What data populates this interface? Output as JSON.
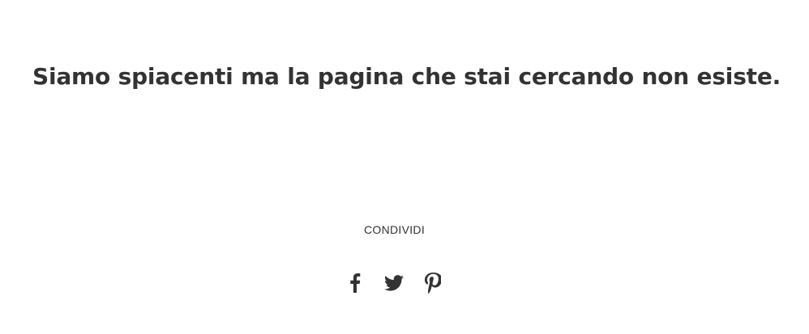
{
  "error": {
    "message": "Siamo spiacenti ma la pagina che stai cercando non esiste."
  },
  "share": {
    "label": "CONDIVIDI",
    "icons": [
      "facebook-icon",
      "twitter-icon",
      "pinterest-icon"
    ]
  },
  "colors": {
    "text": "#333333",
    "background": "#ffffff"
  }
}
